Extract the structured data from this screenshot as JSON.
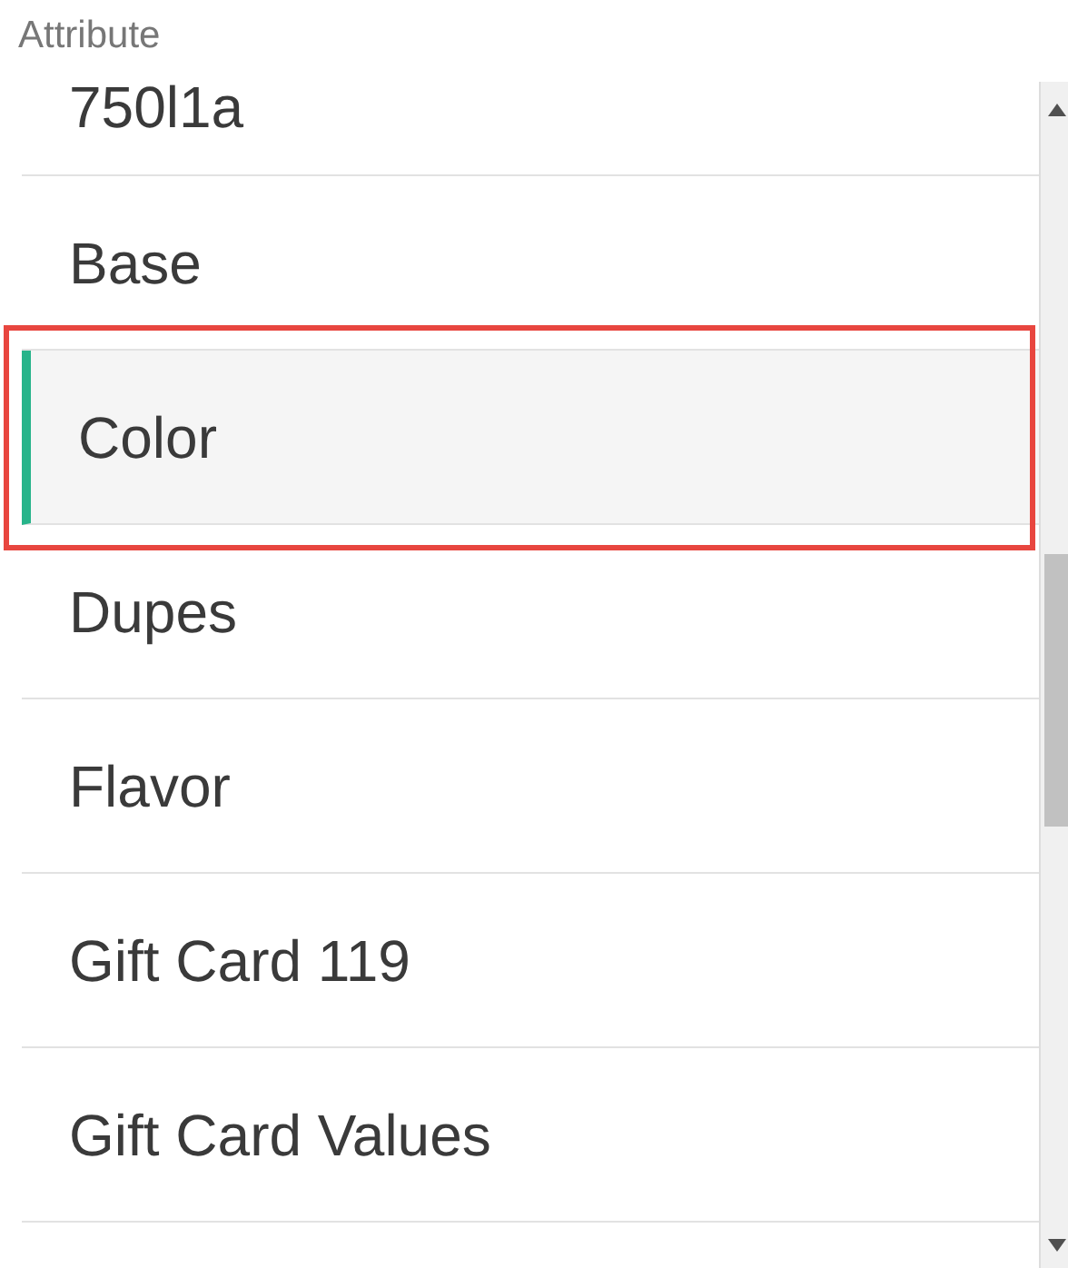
{
  "label": "Attribute",
  "items": [
    {
      "text": "750l1a",
      "selected": false,
      "outlined": false
    },
    {
      "text": "Base",
      "selected": false,
      "outlined": false
    },
    {
      "text": "Color",
      "selected": true,
      "outlined": true
    },
    {
      "text": "Dupes",
      "selected": false,
      "outlined": false
    },
    {
      "text": "Flavor",
      "selected": false,
      "outlined": false
    },
    {
      "text": "Gift Card 119",
      "selected": false,
      "outlined": false
    },
    {
      "text": "Gift Card Values",
      "selected": false,
      "outlined": false
    }
  ]
}
